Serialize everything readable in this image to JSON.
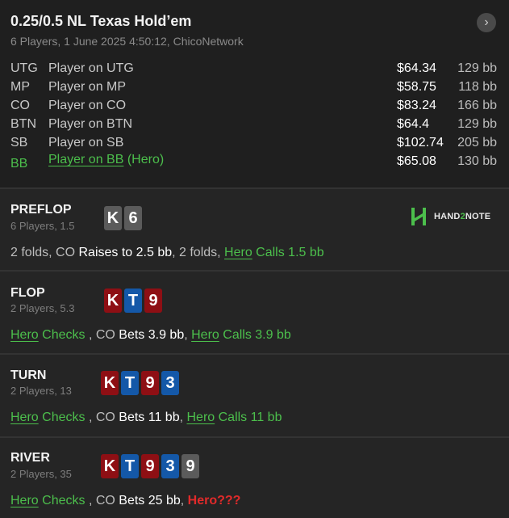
{
  "header": {
    "title": "0.25/0.5 NL Texas Hold’em",
    "subtitle": "6 Players, 1 June 2025 4:50:12, ChicoNetwork",
    "nav_icon": "chevron-right-icon"
  },
  "players": [
    {
      "pos": "UTG",
      "name": "Player on UTG",
      "money": "$64.34",
      "bb": "129 bb"
    },
    {
      "pos": "MP",
      "name": "Player on MP",
      "money": "$58.75",
      "bb": "118 bb"
    },
    {
      "pos": "CO",
      "name": "Player on CO",
      "money": "$83.24",
      "bb": "166 bb"
    },
    {
      "pos": "BTN",
      "name": "Player on BTN",
      "money": "$64.4",
      "bb": "129 bb"
    },
    {
      "pos": "SB",
      "name": "Player on SB",
      "money": "$102.74",
      "bb": "205 bb"
    },
    {
      "pos": "BB",
      "name": "Player on BB",
      "hero_tag": "(Hero)",
      "money": "$65.08",
      "bb": "130 bb"
    }
  ],
  "logo": {
    "prefix": "HAND",
    "two": "2",
    "suffix": "NOTE"
  },
  "streets": {
    "preflop": {
      "title": "PREFLOP",
      "sub": "6 Players, 1.5",
      "cards": [
        {
          "rank": "K",
          "color": "grey"
        },
        {
          "rank": "6",
          "color": "grey"
        }
      ],
      "a1": "2 folds, CO ",
      "a2": "Raises to 2.5 bb",
      "a3": ", 2 folds, ",
      "hero": "Hero",
      "a4": " Calls 1.5 bb"
    },
    "flop": {
      "title": "FLOP",
      "sub": "2 Players, 5.3",
      "cards": [
        {
          "rank": "K",
          "color": "red"
        },
        {
          "rank": "T",
          "color": "blue"
        },
        {
          "rank": "9",
          "color": "red"
        }
      ],
      "hero1": "Hero",
      "a1": " Checks ",
      "a2": ", CO ",
      "a3": "Bets 3.9 bb",
      "a4": ", ",
      "hero2": "Hero",
      "a5": " Calls 3.9 bb"
    },
    "turn": {
      "title": "TURN",
      "sub": "2 Players, 13",
      "cards": [
        {
          "rank": "K",
          "color": "red"
        },
        {
          "rank": "T",
          "color": "blue"
        },
        {
          "rank": "9",
          "color": "red"
        },
        {
          "rank": "3",
          "color": "blue"
        }
      ],
      "hero1": "Hero",
      "a1": " Checks ",
      "a2": ", CO ",
      "a3": "Bets 11 bb",
      "a4": ", ",
      "hero2": "Hero",
      "a5": " Calls 11 bb"
    },
    "river": {
      "title": "RIVER",
      "sub": "2 Players, 35",
      "cards": [
        {
          "rank": "K",
          "color": "red"
        },
        {
          "rank": "T",
          "color": "blue"
        },
        {
          "rank": "9",
          "color": "red"
        },
        {
          "rank": "3",
          "color": "blue"
        },
        {
          "rank": "9",
          "color": "grey"
        }
      ],
      "hero1": "Hero",
      "a1": " Checks ",
      "a2": ", CO ",
      "a3": "Bets 25 bb",
      "a4": ", ",
      "hero_q": "Hero???"
    }
  },
  "colors": {
    "hero_green": "#4cbf4c",
    "card_red": "#8e0f14",
    "card_blue": "#1458a8",
    "card_grey": "#5b5b5b",
    "alert_red": "#e22a2a"
  }
}
